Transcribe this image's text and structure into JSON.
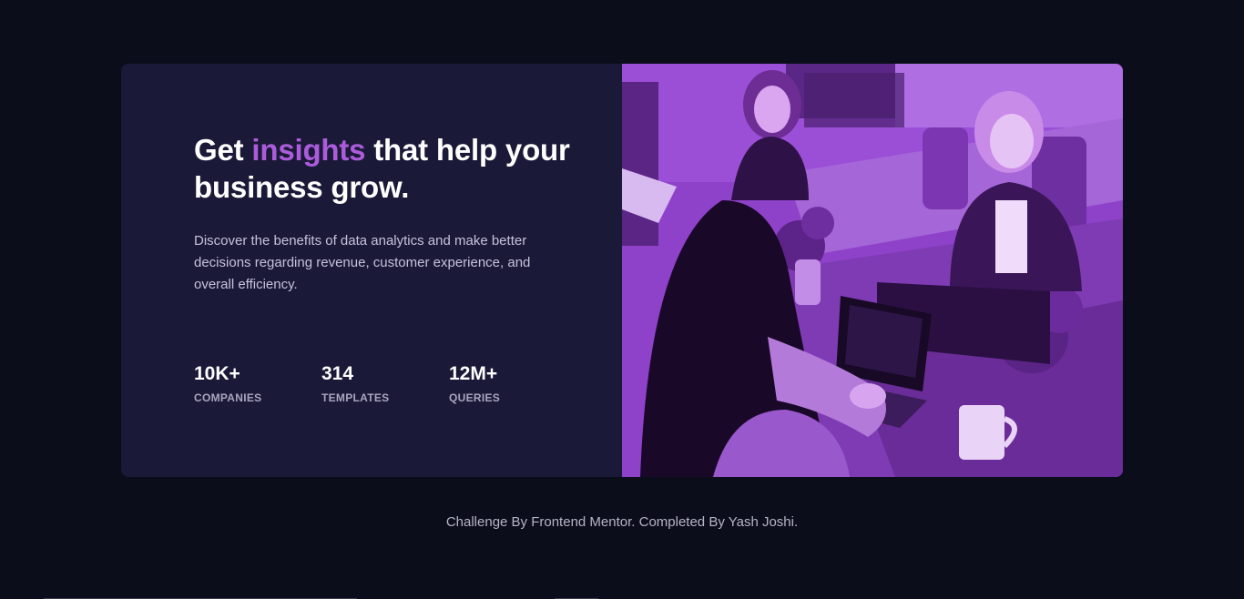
{
  "headline": {
    "before": "Get ",
    "accent": "insights",
    "after": " that help your business grow."
  },
  "description": "Discover the benefits of data analytics and make better decisions regarding revenue, customer experience, and overall efficiency.",
  "stats": [
    {
      "value": "10K+",
      "label": "COMPANIES"
    },
    {
      "value": "314",
      "label": "TEMPLATES"
    },
    {
      "value": "12M+",
      "label": "QUERIES"
    }
  ],
  "footer": "Challenge By Frontend Mentor. Completed By Yash Joshi.",
  "colors": {
    "page_bg": "#0b0d1a",
    "card_bg": "#1b1938",
    "accent": "#ab5cdb",
    "photo_overlay": "#8d40c9"
  }
}
